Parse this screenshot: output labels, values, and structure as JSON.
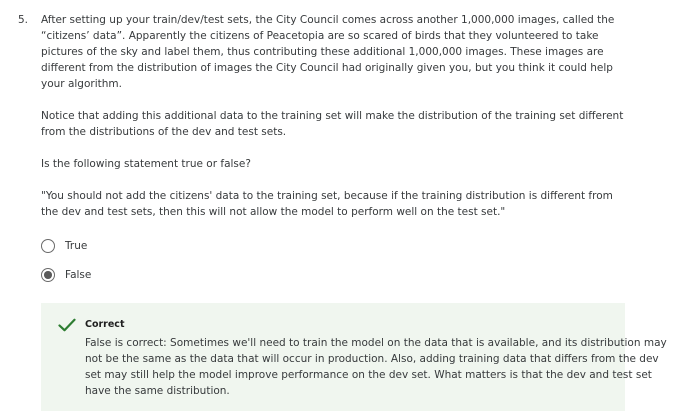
{
  "question": {
    "number": "5.",
    "paragraphs": [
      "After setting up your train/dev/test sets, the City Council comes across another 1,000,000 images, called the “citizens’ data”. Apparently the citizens of Peacetopia are so scared of birds that they volunteered to take pictures of the sky and label them, thus contributing these additional 1,000,000 images. These images are different from the distribution of images the City Council had originally given you, but you think it could help your algorithm.",
      "Notice that adding this additional data to the training set will make the distribution of the training set different from the distributions of the dev and test sets.",
      "Is the following statement true or false?",
      "\"You should not add the citizens' data to the training set, because if the training distribution is different from the dev and test sets, then this will not allow the model to perform well on the test set.\""
    ],
    "options": [
      {
        "label": "True",
        "selected": false
      },
      {
        "label": "False",
        "selected": true
      }
    ]
  },
  "feedback": {
    "status": "Correct",
    "icon": "checkmark-icon",
    "color": "#2e7d32",
    "background": "#f0f6ef",
    "text": "False is correct: Sometimes we'll need to train the model on the data that is available, and its distribution may not be the same as the data that will occur in production. Also, adding training data that differs from the dev set may still help the model improve performance on the dev set. What matters is that the dev and test set have the same distribution."
  }
}
